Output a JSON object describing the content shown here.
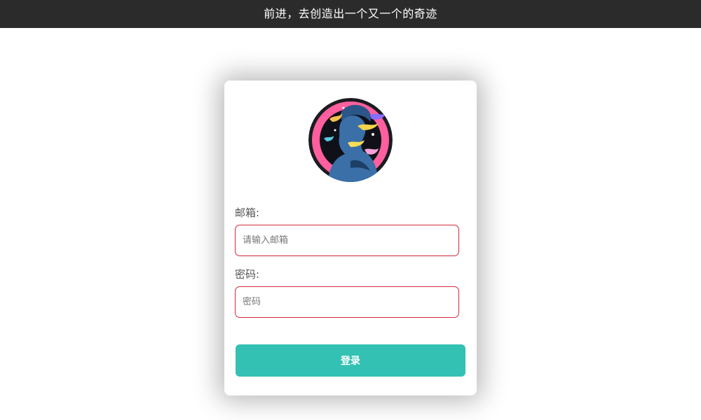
{
  "header": {
    "title": "前进，去创造出一个又一个的奇迹"
  },
  "login_form": {
    "email_label": "邮箱:",
    "email_placeholder": "请输入邮箱",
    "email_value": "",
    "password_label": "密码:",
    "password_placeholder": "密码",
    "password_value": "",
    "login_button": "登录"
  },
  "colors": {
    "header_bg": "#2b2b2b",
    "input_border": "#d42a3a",
    "button_bg": "#33c1b3",
    "avatar_ring": "#ff5f9e"
  }
}
